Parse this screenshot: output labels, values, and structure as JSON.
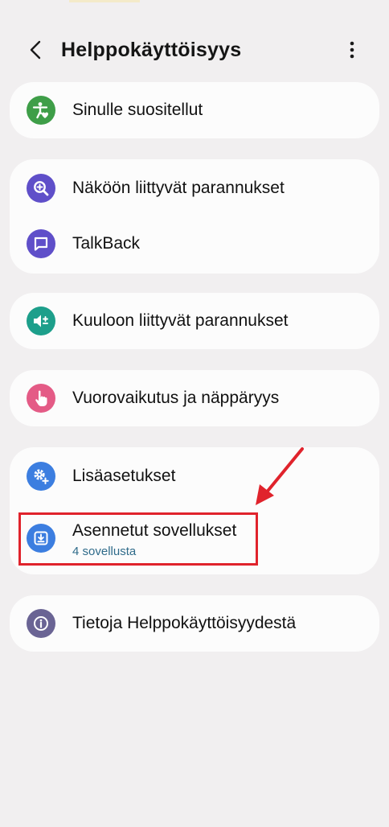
{
  "header": {
    "title": "Helppokäyttöisyys",
    "back_icon": "chevron-left-icon",
    "more_icon": "more-vertical-icon"
  },
  "menu": {
    "recommended": {
      "label": "Sinulle suositellut",
      "icon": "accessibility-heart-icon",
      "color": "#3e9e48"
    },
    "vision": {
      "label": "Näköön liittyvät parannukset",
      "icon": "magnifier-plus-icon",
      "color": "#5f4fc9"
    },
    "talkback": {
      "label": "TalkBack",
      "icon": "speech-bubble-icon",
      "color": "#5f4fc9"
    },
    "hearing": {
      "label": "Kuuloon liittyvät parannukset",
      "icon": "speaker-volume-icon",
      "color": "#1d9f8b"
    },
    "interaction": {
      "label": "Vuorovaikutus ja näppäryys",
      "icon": "hand-touch-icon",
      "color": "#e45b86"
    },
    "advanced": {
      "label": "Lisäasetukset",
      "icon": "gears-plus-icon",
      "color": "#3c7ee0"
    },
    "installed": {
      "label": "Asennetut sovellukset",
      "sublabel": "4 sovellusta",
      "icon": "download-box-icon",
      "color": "#3c7ee0"
    },
    "about": {
      "label": "Tietoja Helppokäyttöisyydestä",
      "icon": "info-icon",
      "color": "#6a6494"
    }
  },
  "annotation": {
    "highlight_color": "#e0232c"
  }
}
